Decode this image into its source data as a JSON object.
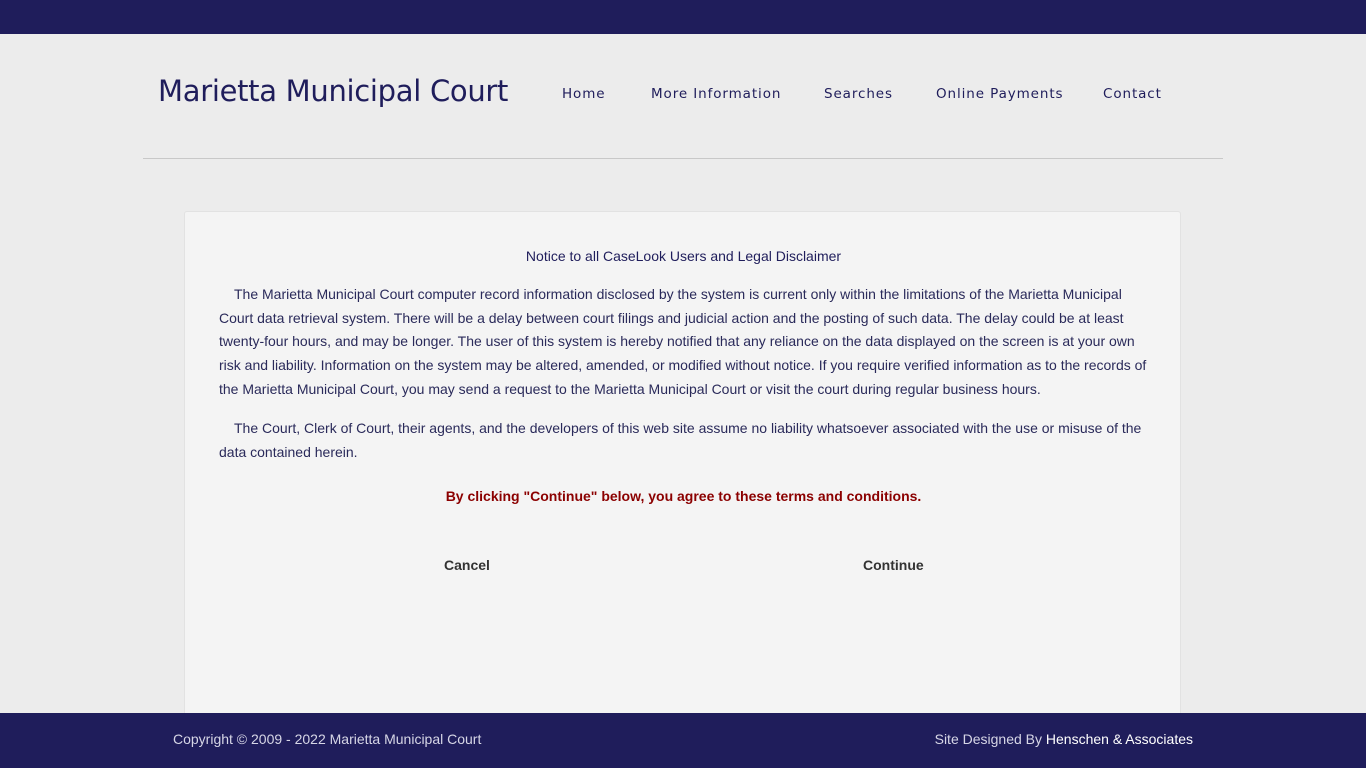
{
  "header": {
    "site_title": "Marietta Municipal Court",
    "nav": [
      {
        "label": "Home"
      },
      {
        "label": "More Information"
      },
      {
        "label": "Searches"
      },
      {
        "label": "Online Payments"
      },
      {
        "label": "Contact"
      }
    ]
  },
  "notice": {
    "title": "Notice to all CaseLook Users and Legal Disclaimer",
    "paragraphs": [
      "The Marietta Municipal Court computer record information disclosed by the system is current only within the limitations of the Marietta Municipal Court data retrieval system. There will be a delay between court filings and judicial action and the posting of such data. The delay could be at least twenty-four hours, and may be longer. The user of this system is hereby notified that any reliance on the data displayed on the screen is at your own risk and liability. Information on the system may be altered, amended, or modified without notice. If you require verified information as to the records of the Marietta Municipal Court, you may send a request to the Marietta Municipal Court or visit the court during regular business hours.",
      "The Court, Clerk of Court, their agents, and the developers of this web site assume no liability whatsoever associated with the use or misuse of the data contained herein."
    ],
    "agreement": "By clicking \"Continue\" below, you agree to these terms and conditions.",
    "cancel_label": "Cancel",
    "continue_label": "Continue"
  },
  "footer": {
    "copyright": "Copyright © 2009 - 2022 Marietta Municipal Court",
    "designed_by": "Site Designed By ",
    "designer_link": "Henschen & Associates"
  },
  "colors": {
    "brand_navy": "#1f1d5b",
    "warning_red": "#8b0000",
    "page_background": "#ececec"
  }
}
